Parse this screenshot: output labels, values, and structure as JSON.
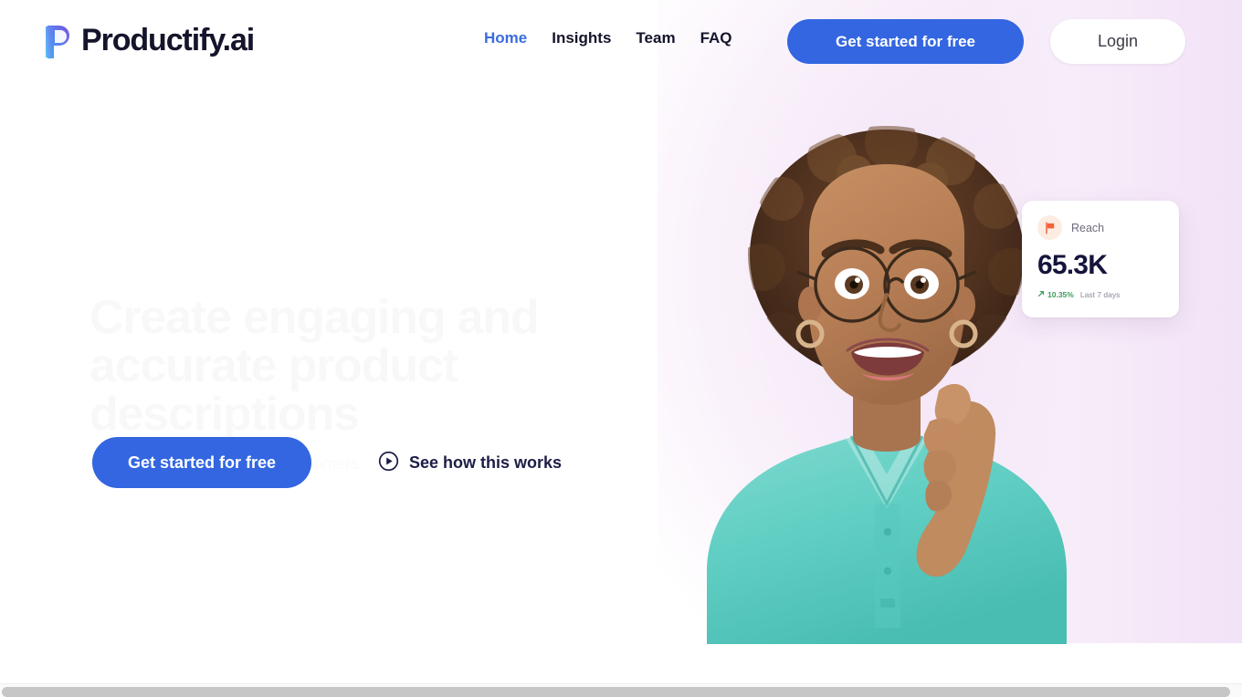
{
  "brand": {
    "name": "Productify.ai",
    "logo_icon": "productify-p-logo-icon",
    "gradient_start": "#4f8ff7",
    "gradient_end": "#7b5ce0"
  },
  "header": {
    "nav": [
      {
        "label": "Home",
        "active": true
      },
      {
        "label": "Insights",
        "active": false
      },
      {
        "label": "Team",
        "active": false
      },
      {
        "label": "FAQ",
        "active": false
      }
    ],
    "cta_label": "Get started for free",
    "login_label": "Login"
  },
  "hero": {
    "title": "Create engaging and accurate product descriptions",
    "subtitle": "that convert shoppers into customers.",
    "cta_label": "Get started for free",
    "video_link_label": "See how this works",
    "video_icon": "play-circle-icon",
    "photo_alt": "smiling woman with afro hair and round glasses wearing a teal polo shirt"
  },
  "stat_card": {
    "icon": "flag-icon",
    "label": "Reach",
    "value": "65.3K",
    "delta": "10.35%",
    "delta_icon": "arrow-up-right-icon",
    "period": "Last 7 days"
  },
  "colors": {
    "primary_blue": "#3366e0",
    "nav_active": "#3b6ce0",
    "dark_navy": "#14142b",
    "stat_value": "#14143c",
    "delta_green": "#3f9b5e",
    "flag_orange": "#f4623a",
    "wash_lavender": "#f3e6f7"
  },
  "scrollbar": {
    "orientation": "horizontal"
  }
}
